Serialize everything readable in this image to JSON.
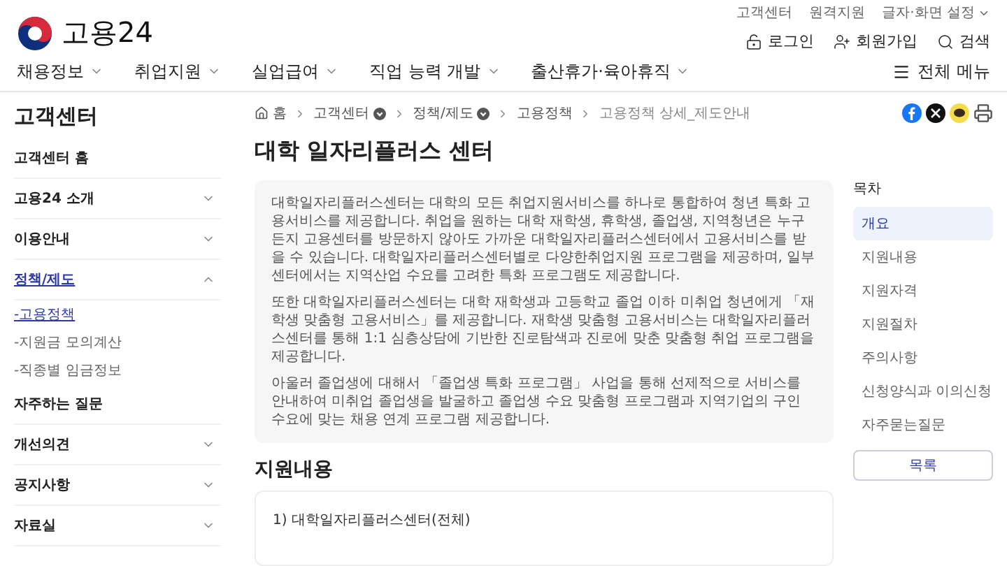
{
  "utility_links": [
    {
      "label": "고객센터",
      "kind": "link"
    },
    {
      "label": "원격지원",
      "kind": "link"
    },
    {
      "label": "글자·화면 설정",
      "kind": "dropdown"
    }
  ],
  "logo": {
    "text": "고용24"
  },
  "account_links": [
    {
      "label": "로그인",
      "kind": "login"
    },
    {
      "label": "회원가입",
      "kind": "signup"
    },
    {
      "label": "검색",
      "kind": "search"
    }
  ],
  "main_nav": [
    "채용정보",
    "취업지원",
    "실업급여",
    "직업 능력 개발",
    "출산휴가·육아휴직"
  ],
  "all_menu": "전체 메뉴",
  "sidebar": {
    "title": "고객센터",
    "items": [
      {
        "label": "고객센터 홈",
        "kind": "link"
      },
      {
        "label": "고용24 소개",
        "kind": "group",
        "expanded": false
      },
      {
        "label": "이용안내",
        "kind": "group",
        "expanded": false
      },
      {
        "label": "정책/제도",
        "kind": "group",
        "expanded": true,
        "children": [
          {
            "label": "-고용정책",
            "selected": true
          },
          {
            "label": "-지원금 모의계산",
            "selected": false
          },
          {
            "label": "-직종별 임금정보",
            "selected": false
          }
        ]
      },
      {
        "label": "자주하는 질문",
        "kind": "link"
      },
      {
        "label": "개선의견",
        "kind": "group",
        "expanded": false
      },
      {
        "label": "공지사항",
        "kind": "group",
        "expanded": false
      },
      {
        "label": "자료실",
        "kind": "group",
        "expanded": false
      }
    ]
  },
  "breadcrumb": [
    {
      "label": "홈",
      "kind": "home"
    },
    {
      "label": "고객센터",
      "kind": "dropdown"
    },
    {
      "label": "정책/제도",
      "kind": "dropdown"
    },
    {
      "label": "고용정책",
      "kind": "link"
    },
    {
      "label": "고용정책 상세_제도안내",
      "kind": "current"
    }
  ],
  "title": "대학 일자리플러스 센터",
  "intro": [
    "대학일자리플러스센터는 대학의 모든 취업지원서비스를 하나로 통합하여 청년 특화 고용서비스를 제공합니다. 취업을 원하는 대학 재학생, 휴학생, 졸업생, 지역청년은 누구든지 고용센터를 방문하지 않아도 가까운 대학일자리플러스센터에서 고용서비스를 받을 수 있습니다. 대학일자리플러스센터별로 다양한취업지원 프로그램을 제공하며, 일부 센터에서는 지역산업 수요를 고려한 특화 프로그램도 제공합니다.",
    "또한 대학일자리플러스센터는 대학 재학생과 고등학교 졸업 이하 미취업 청년에게 「재학생 맞춤형 고용서비스」를 제공합니다. 재학생 맞춤형 고용서비스는 대학일자리플러스센터를 통해 1:1 심층상담에 기반한 진로탐색과 진로에 맞춘 맞춤형 취업 프로그램을 제공합니다.",
    "아울러 졸업생에 대해서 「졸업생 특화 프로그램」 사업을 통해 선제적으로 서비스를 안내하여 미취업 졸업생을 발굴하고 졸업생 수요 맞춤형 프로그램과 지역기업의 구인 수요에 맞는 채용 연계 프로그램 제공합니다."
  ],
  "section_title": "지원내용",
  "section_item": "1) 대학일자리플러스센터(전체)",
  "toc": {
    "title": "목차",
    "items": [
      {
        "label": "개요",
        "selected": true
      },
      {
        "label": "지원내용",
        "selected": false
      },
      {
        "label": "지원자격",
        "selected": false
      },
      {
        "label": "지원절차",
        "selected": false
      },
      {
        "label": "주의사항",
        "selected": false
      },
      {
        "label": "신청양식과 이의신청",
        "selected": false
      },
      {
        "label": "자주묻는질문",
        "selected": false
      }
    ],
    "button": "목록"
  }
}
